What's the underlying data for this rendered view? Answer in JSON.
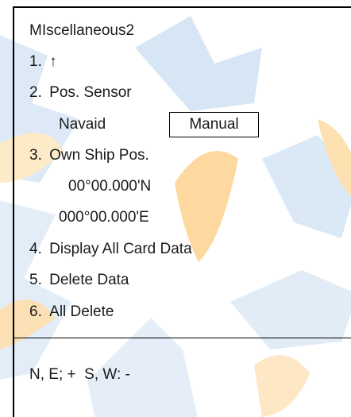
{
  "title": "MIscellaneous2",
  "items": [
    {
      "number": "1.",
      "label": "↑"
    },
    {
      "number": "2.",
      "label": "Pos. Sensor"
    },
    {
      "number": "3.",
      "label": "Own Ship Pos."
    },
    {
      "number": "4.",
      "label": "Display All Card Data"
    },
    {
      "number": "5.",
      "label": "Delete Data"
    },
    {
      "number": "6.",
      "label": "All Delete"
    }
  ],
  "pos_sensor": {
    "option_navaid": "Navaid",
    "option_manual": "Manual",
    "selected": "Manual"
  },
  "own_ship": {
    "lat": "00°00.000'N",
    "lon": "000°00.000'E"
  },
  "footer": {
    "sign_note": "N, E; +  S, W: -"
  },
  "colors": {
    "watermark_blue": "#c9dcf0",
    "watermark_orange": "#f8c27a",
    "text": "#1a1a1a"
  }
}
